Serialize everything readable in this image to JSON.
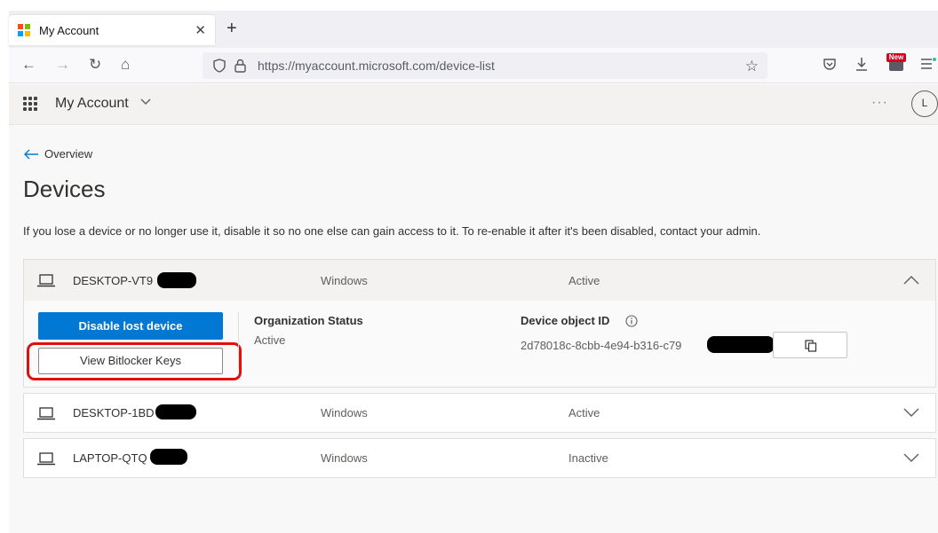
{
  "browser": {
    "tab_title": "My Account",
    "tab_close": "✕",
    "new_tab": "+",
    "url": "https://myaccount.microsoft.com/device-list",
    "back": "←",
    "forward": "→",
    "reload": "↻",
    "home": "⌂",
    "star": "☆",
    "new_badge": "New"
  },
  "app": {
    "title": "My Account",
    "more": "···",
    "avatar_initial": "L"
  },
  "page": {
    "back_label": "Overview",
    "title": "Devices",
    "description": "If you lose a device or no longer use it, disable it so no one else can gain access to it. To re-enable it after it's been disabled, contact your admin."
  },
  "devices": [
    {
      "name": "DESKTOP-VT9",
      "os": "Windows",
      "status": "Active",
      "expanded": true
    },
    {
      "name": "DESKTOP-1BD",
      "os": "Windows",
      "status": "Active",
      "expanded": false
    },
    {
      "name": "LAPTOP-QTQ",
      "os": "Windows",
      "status": "Inactive",
      "expanded": false
    }
  ],
  "detail": {
    "disable_label": "Disable lost device",
    "bitlocker_label": "View Bitlocker Keys",
    "org_status_label": "Organization Status",
    "org_status_value": "Active",
    "device_id_label": "Device object ID",
    "device_id_value": "2d78018c-8cbb-4e94-b316-c79"
  },
  "colors": {
    "primary": "#0078d4",
    "highlight": "#e01010",
    "text": "#323130"
  }
}
